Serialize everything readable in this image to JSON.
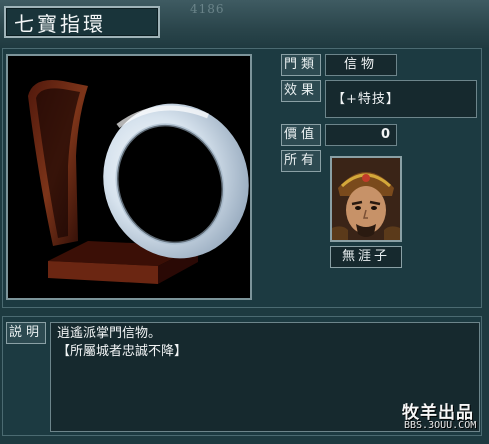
{
  "item": {
    "name": "七寶指環",
    "class_label": "門類",
    "class_value": "信物",
    "effect_label": "效果",
    "effect_value": "【+特技】",
    "value_label": "價值",
    "value_value": "0",
    "owner_label": "所有",
    "owner_name": "無涯子"
  },
  "description": {
    "label": "説明",
    "lines": [
      "逍遙派掌門信物。",
      "【所屬城者忠誠不降】"
    ]
  },
  "background_counter": "4186",
  "watermark": {
    "title": "牧羊出品",
    "url": "BBS.3OUU.COM"
  },
  "colors": {
    "panel": "#1c3a41",
    "field": "#16292e",
    "label_bg": "#2d4a51",
    "border": "#8aa0a5"
  }
}
